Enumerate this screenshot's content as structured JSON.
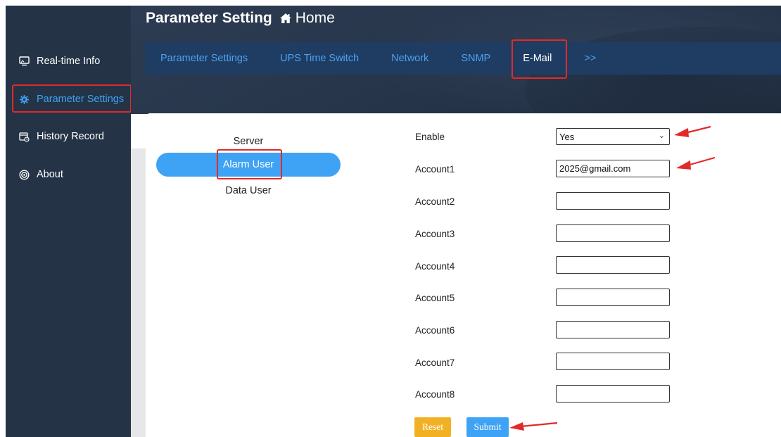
{
  "sidebar": {
    "items": [
      {
        "label": "Real-time Info",
        "icon": "monitor-icon"
      },
      {
        "label": "Parameter Settings",
        "icon": "gear-icon"
      },
      {
        "label": "History Record",
        "icon": "history-icon"
      },
      {
        "label": "About",
        "icon": "about-icon"
      }
    ]
  },
  "header": {
    "title": "Parameter Setting",
    "home_label": "Home",
    "tabs": [
      {
        "label": "Parameter Settings"
      },
      {
        "label": "UPS Time Switch"
      },
      {
        "label": "Network"
      },
      {
        "label": "SNMP"
      },
      {
        "label": "E-Mail"
      },
      {
        "label": ">>"
      }
    ]
  },
  "submenu": {
    "items": [
      {
        "label": "Server"
      },
      {
        "label": "Alarm User"
      },
      {
        "label": "Data User"
      }
    ]
  },
  "form": {
    "enable_label": "Enable",
    "enable_value": "Yes",
    "accounts": [
      {
        "label": "Account1",
        "value": "2025@gmail.com"
      },
      {
        "label": "Account2",
        "value": ""
      },
      {
        "label": "Account3",
        "value": ""
      },
      {
        "label": "Account4",
        "value": ""
      },
      {
        "label": "Account5",
        "value": ""
      },
      {
        "label": "Account6",
        "value": ""
      },
      {
        "label": "Account7",
        "value": ""
      },
      {
        "label": "Account8",
        "value": ""
      }
    ],
    "reset_label": "Reset",
    "submit_label": "Submit"
  },
  "colors": {
    "sidebar_bg": "#243346",
    "accent": "#3ea2f5",
    "highlight": "#e22a2a",
    "reset": "#f2b125"
  }
}
